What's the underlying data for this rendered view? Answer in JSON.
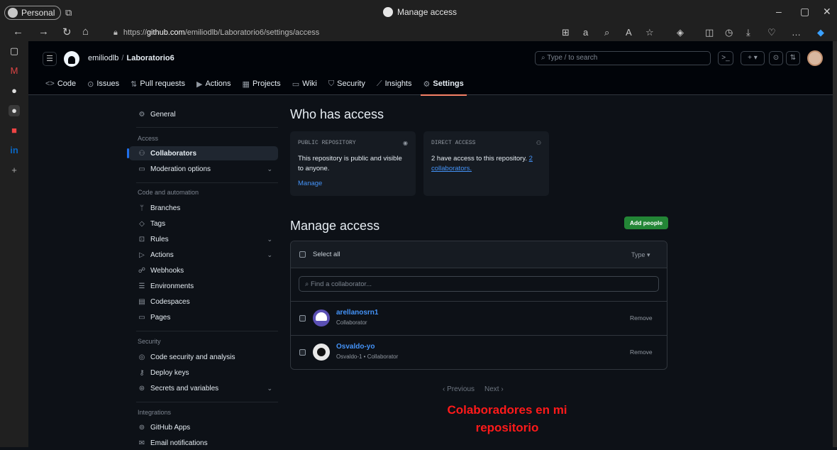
{
  "browser": {
    "profile": "Personal",
    "window_title": "Manage access",
    "url_prefix": "https://",
    "url_host": "github.com",
    "url_path": "/emiliodlb/Laboratorio6/settings/access"
  },
  "header": {
    "owner": "emiliodlb",
    "separator": "/",
    "repo": "Laboratorio6",
    "search_placeholder": "Type / to search",
    "tabs": [
      {
        "label": "Code",
        "icon": "code-icon"
      },
      {
        "label": "Issues",
        "icon": "issues-icon"
      },
      {
        "label": "Pull requests",
        "icon": "pull-request-icon"
      },
      {
        "label": "Actions",
        "icon": "actions-icon"
      },
      {
        "label": "Projects",
        "icon": "projects-icon"
      },
      {
        "label": "Wiki",
        "icon": "wiki-icon"
      },
      {
        "label": "Security",
        "icon": "shield-icon"
      },
      {
        "label": "Insights",
        "icon": "graph-icon"
      },
      {
        "label": "Settings",
        "icon": "gear-icon",
        "selected": true
      }
    ]
  },
  "sidebar": {
    "general": "General",
    "access_heading": "Access",
    "collaborators": "Collaborators",
    "moderation": "Moderation options",
    "code_heading": "Code and automation",
    "branches": "Branches",
    "tags": "Tags",
    "rules": "Rules",
    "actions": "Actions",
    "webhooks": "Webhooks",
    "environments": "Environments",
    "codespaces": "Codespaces",
    "pages": "Pages",
    "security_heading": "Security",
    "code_security": "Code security and analysis",
    "deploy_keys": "Deploy keys",
    "secrets": "Secrets and variables",
    "integrations_heading": "Integrations",
    "github_apps": "GitHub Apps",
    "email_notifications": "Email notifications"
  },
  "who": {
    "title": "Who has access",
    "public_label": "PUBLIC REPOSITORY",
    "public_text": "This repository is public and visible to anyone.",
    "manage": "Manage",
    "direct_label": "DIRECT ACCESS",
    "direct_text": "2 have access to this repository.",
    "direct_count_link": "2",
    "direct_link": "collaborators."
  },
  "manage": {
    "title": "Manage access",
    "add_people": "Add people",
    "select_all": "Select all",
    "type": "Type",
    "find_placeholder": "Find a collaborator...",
    "collaborators": [
      {
        "name": "arellanosrn1",
        "role": "Collaborator",
        "remove": "Remove"
      },
      {
        "name": "Osvaldo-yo",
        "role": "Osvaldo-1 • Collaborator",
        "remove": "Remove"
      }
    ],
    "previous": "Previous",
    "next": "Next"
  },
  "annotation": {
    "line1": "Colaboradores en mi",
    "line2": "repositorio"
  },
  "colors": {
    "accent": "#f78166",
    "link": "#4493f8",
    "primary_button": "#238636",
    "annotation": "#ff1a1a"
  }
}
